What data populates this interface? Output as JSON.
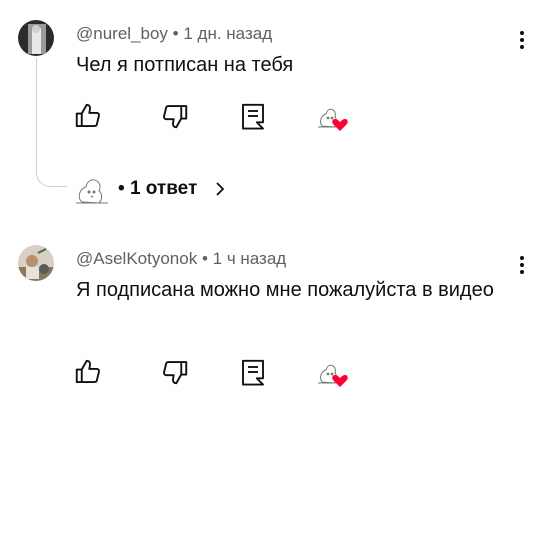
{
  "comments": [
    {
      "author": "@nurel_boy",
      "time": "1 дн. назад",
      "text": "Чел я потписан на тебя",
      "replies_label": "1 ответ"
    },
    {
      "author": "@AselKotyonok",
      "time": "1 ч назад",
      "text": "Я подписана можно мне пожалуйста в видео"
    }
  ],
  "meta_separator": "•",
  "icons": [
    "more-vert-icon",
    "like-icon",
    "dislike-icon",
    "reply-icon",
    "creator-heart-icon",
    "chevron-right-icon"
  ],
  "colors": {
    "heart": "#ff0033",
    "meta": "#606060",
    "text": "#0f0f0f"
  }
}
